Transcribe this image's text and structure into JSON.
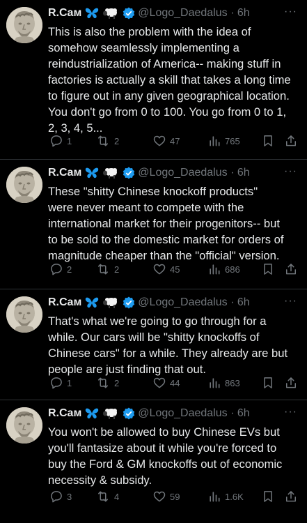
{
  "colors": {
    "background": "#000000",
    "text": "#e7e9ea",
    "muted": "#71767b",
    "verified": "#1d9bf0",
    "butterfly": "#1d9bf0",
    "divider": "#2f3336"
  },
  "tweets": [
    {
      "author": "R.Cам",
      "handle": "@Logo_Daedalus",
      "time": "6h",
      "more": "···",
      "text_lines": [
        "This is also the problem with the idea of",
        "somehow seamlessly implementing a",
        "reindustrialization of America-- making stuff in",
        "factories is actually a skill that takes a long time",
        "to figure out in any given geographical location.",
        "You don't go from 0 to 100. You go from 0 to 1,",
        "2, 3, 4, 5..."
      ],
      "replies": "1",
      "retweets": "2",
      "likes": "47",
      "views": "765"
    },
    {
      "author": "R.Cам",
      "handle": "@Logo_Daedalus",
      "time": "6h",
      "more": "···",
      "text_lines": [
        "These \"shitty Chinese knockoff products\"",
        "were never meant to compete with the",
        "international market for their progenitors-- but",
        "to be sold to the domestic market for orders of",
        "magnitude cheaper than the \"official\" version."
      ],
      "replies": "2",
      "retweets": "2",
      "likes": "45",
      "views": "686"
    },
    {
      "author": "R.Cам",
      "handle": "@Logo_Daedalus",
      "time": "6h",
      "more": "···",
      "text_lines": [
        "That's what we're going to go through for a",
        "while. Our cars will be \"shitty knockoffs of",
        "Chinese cars\" for a while. They already are but",
        "people are just finding that out."
      ],
      "replies": "1",
      "retweets": "2",
      "likes": "44",
      "views": "863"
    },
    {
      "author": "R.Cам",
      "handle": "@Logo_Daedalus",
      "time": "6h",
      "more": "···",
      "text_lines": [
        "You won't be allowed to buy Chinese EVs but",
        "you'll fantasize about it while you're forced to",
        "buy the Ford & GM knockoffs out of economic",
        "necessity & subsidy."
      ],
      "replies": "3",
      "retweets": "4",
      "likes": "59",
      "views": "1.6K"
    }
  ]
}
